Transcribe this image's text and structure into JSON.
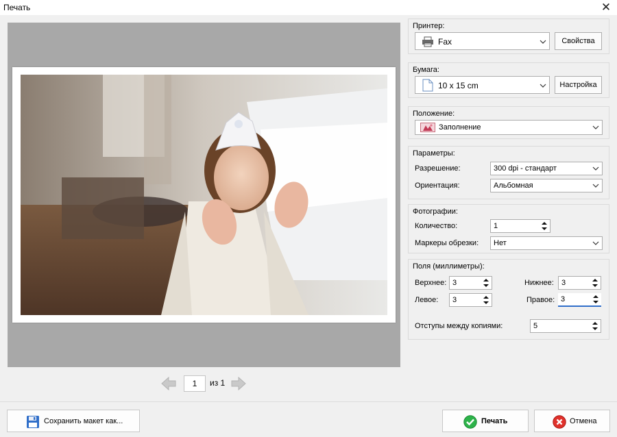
{
  "window": {
    "title": "Печать",
    "close_icon": "close-icon"
  },
  "preview": {
    "page_current": "1",
    "page_of": "из 1"
  },
  "printer": {
    "group_label": "Принтер:",
    "selected": "Fax",
    "properties_label": "Свойства",
    "icon": "printer-icon"
  },
  "paper": {
    "group_label": "Бумага:",
    "selected": "10 x 15 cm",
    "setup_label": "Настройка",
    "icon": "page-icon"
  },
  "position": {
    "group_label": "Положение:",
    "selected": "Заполнение",
    "icon": "fill-image-icon"
  },
  "params": {
    "group_label": "Параметры:",
    "resolution_label": "Разрешение:",
    "resolution_value": "300 dpi - стандарт",
    "orientation_label": "Ориентация:",
    "orientation_value": "Альбомная"
  },
  "photos": {
    "group_label": "Фотографии:",
    "count_label": "Количество:",
    "count_value": "1",
    "crop_marks_label": "Маркеры обрезки:",
    "crop_marks_value": "Нет"
  },
  "margins": {
    "group_label": "Поля (миллиметры):",
    "top_label": "Верхнее:",
    "top_value": "3",
    "bottom_label": "Нижнее:",
    "bottom_value": "3",
    "left_label": "Левое:",
    "left_value": "3",
    "right_label": "Правое:",
    "right_value": "3",
    "spacing_label": "Отступы между копиями:",
    "spacing_value": "5"
  },
  "footer": {
    "save_layout_label": "Сохранить макет как...",
    "print_label": "Печать",
    "cancel_label": "Отмена"
  },
  "colors": {
    "accent": "#2f6ec9",
    "ok_green": "#2db34a",
    "cancel_red": "#e0312b"
  }
}
